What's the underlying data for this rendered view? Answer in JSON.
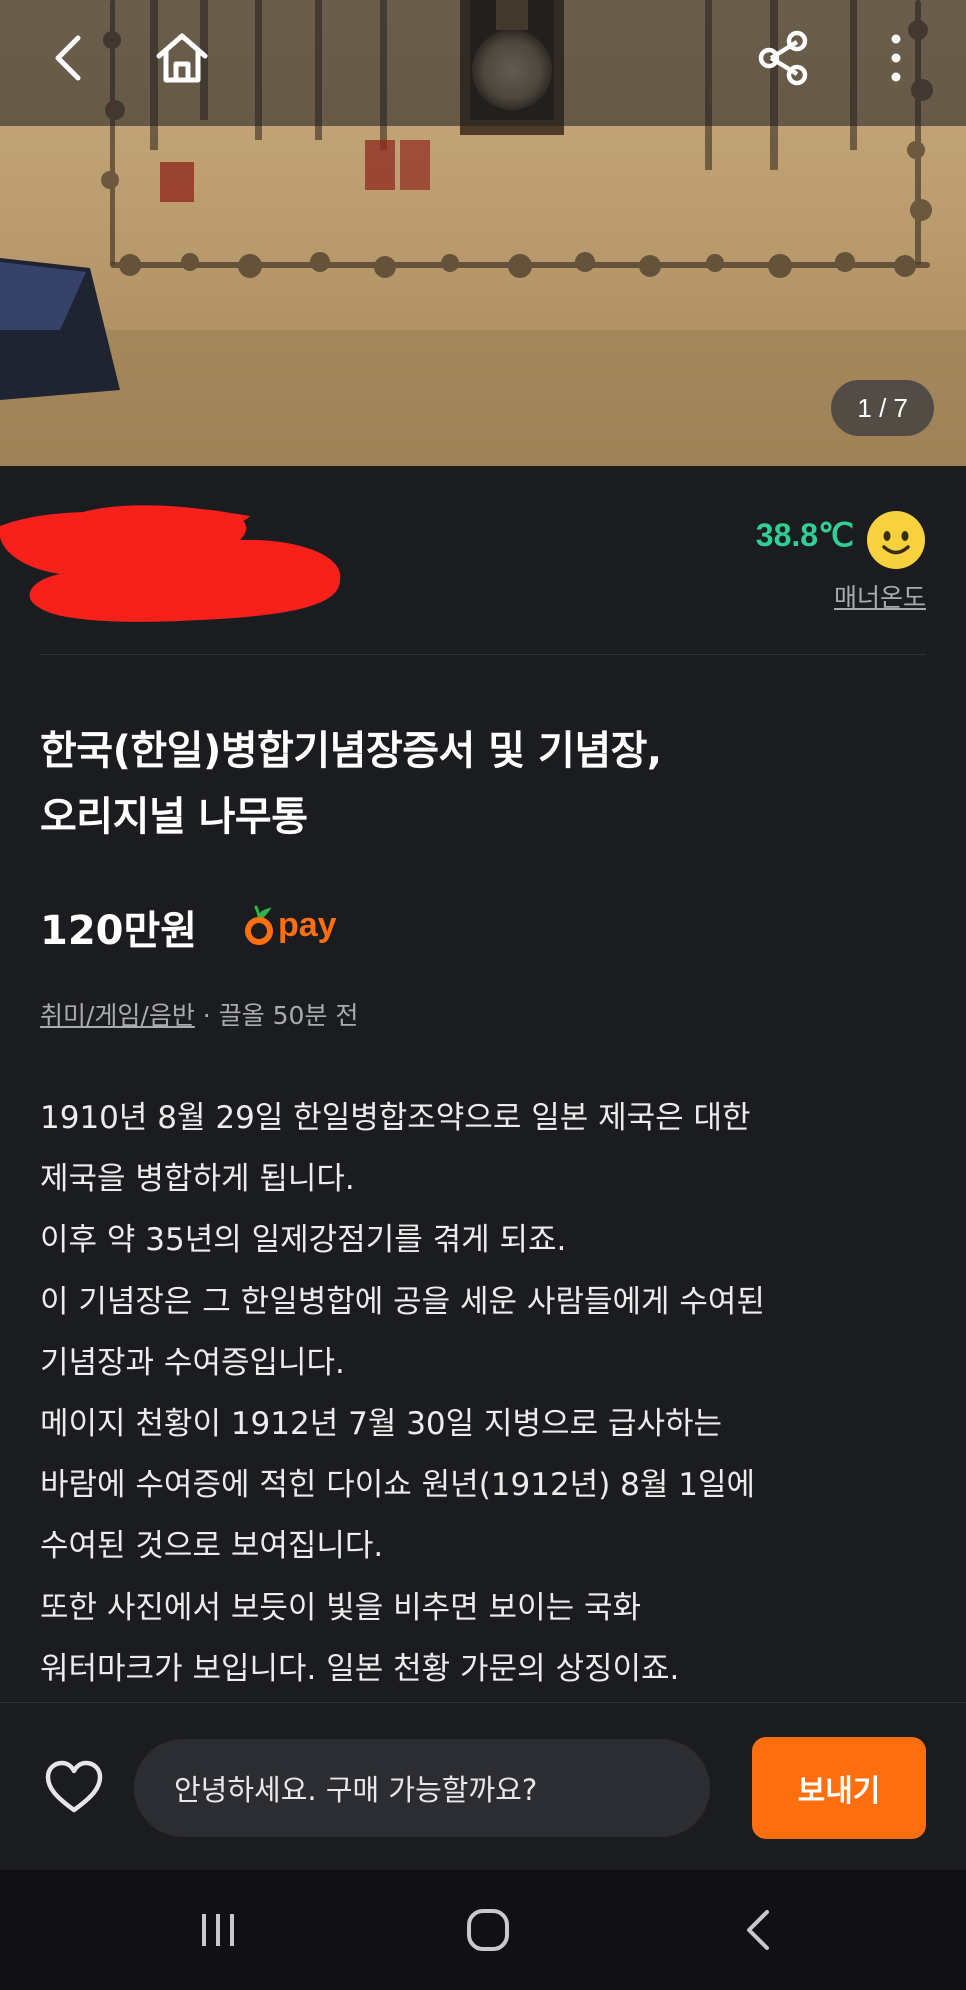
{
  "hero": {
    "image_counter": "1 / 7"
  },
  "header_icons": {
    "back": "chevron-left-icon",
    "home": "home-icon",
    "share": "share-icon",
    "more": "more-vertical-icon"
  },
  "seller": {
    "manner_temperature": "38.8℃",
    "manner_label": "매너온도",
    "manner_face_icon": "smiley-face-icon"
  },
  "listing": {
    "title_line1": "한국(한일)병합기념장증서 및 기념장,",
    "title_line2": "오리지널 나무통",
    "price": "120만원",
    "pay_label": "pay",
    "category": "취미/게임/음반",
    "time_ago": " · 끌올 50분 전",
    "description": [
      "1910년 8월 29일 한일병합조약으로 일본 제국은  대한",
      "제국을 병합하게 됩니다.",
      "이후 약 35년의 일제강점기를 겪게 되죠.",
      "이 기념장은 그 한일병합에 공을 세운 사람들에게 수여된",
      "기념장과 수여증입니다.",
      "메이지 천황이 1912년 7월 30일 지병으로 급사하는",
      "바람에 수여증에 적힌 다이쇼 원년(1912년) 8월 1일에",
      "수여된 것으로 보여집니다.",
      "또한 사진에서 보듯이 빛을 비추면 보이는 국화",
      "워터마크가 보입니다. 일본 천황 가문의 상징이죠."
    ]
  },
  "chat": {
    "input_value": "안녕하세요. 구매 가능할까요?",
    "send_label": "보내기"
  },
  "colors": {
    "accent": "#ff6f0f",
    "manner_green": "#2fcf95",
    "background": "#1b1c20"
  }
}
